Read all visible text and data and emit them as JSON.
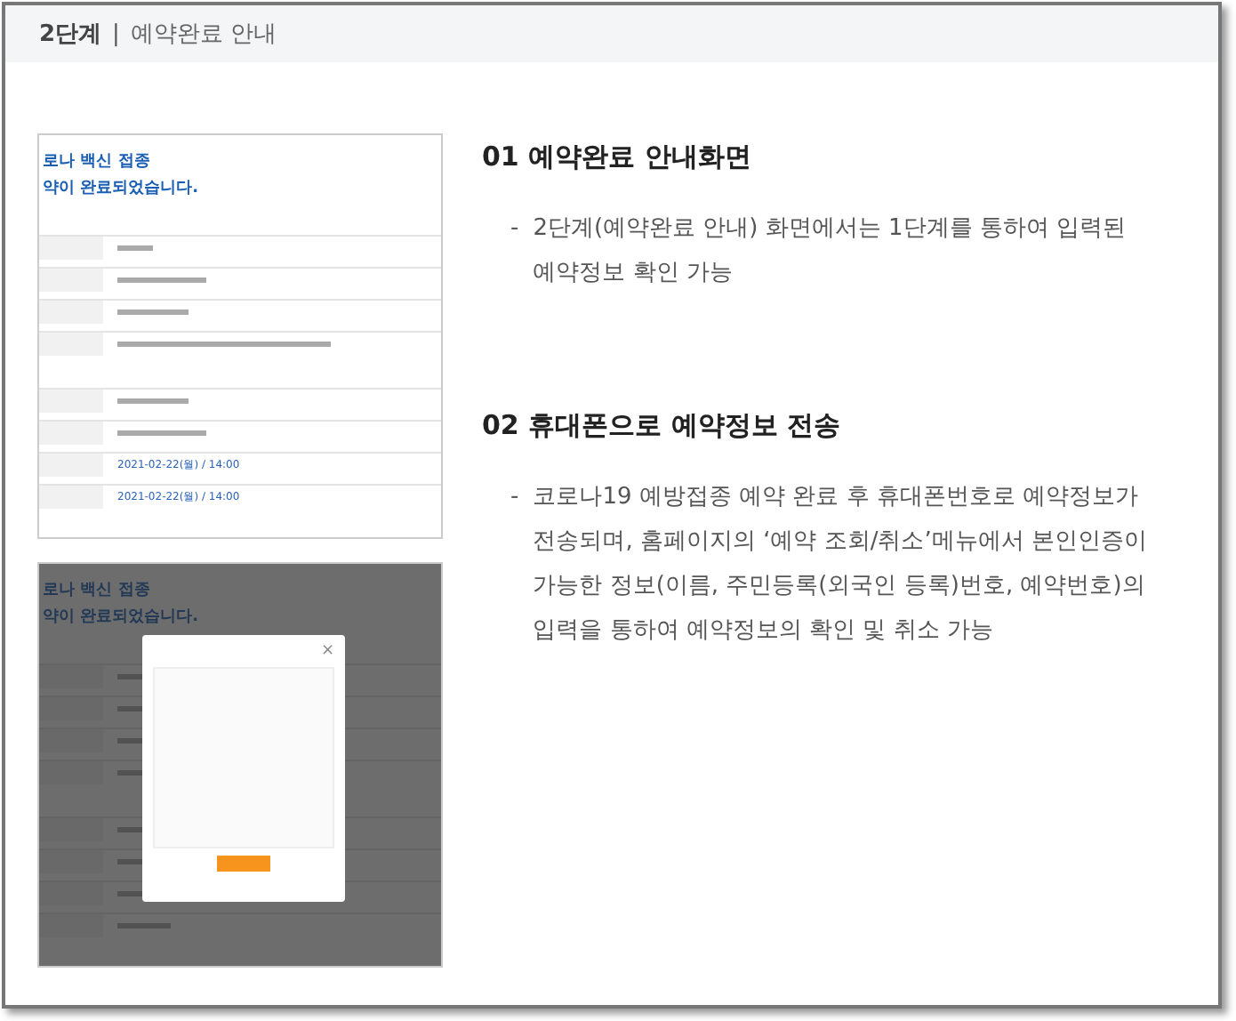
{
  "header": {
    "step": "2단계",
    "separator": "|",
    "title": "예약완료 안내"
  },
  "thumbnails": [
    {
      "heading": [
        "로나 백신 접종",
        "약이 완료되었습니다."
      ],
      "dimmed": false,
      "dates": [
        "2021-02-22(월) / 14:00",
        "2021-02-22(월) / 14:00"
      ]
    },
    {
      "heading": [
        "로나 백신 접종",
        "약이 완료되었습니다."
      ],
      "dimmed": true,
      "modal": {
        "close": "×"
      }
    }
  ],
  "sections": [
    {
      "title": "01 예약완료 안내화면",
      "bullet": "-",
      "text": "2단계(예약완료 안내) 화면에서는 1단계를 통하여 입력된 예약정보 확인 가능"
    },
    {
      "title": "02 휴대폰으로 예약정보 전송",
      "bullet": "-",
      "text": "코로나19 예방접종 예약 완료 후 휴대폰번호로 예약정보가 전송되며, 홈페이지의 ‘예약 조회/취소’메뉴에서 본인인증이 가능한 정보(이름, 주민등록(외국인 등록)번호, 예약번호)의 입력을 통하여 예약정보의 확인 및 취소 가능"
    }
  ]
}
